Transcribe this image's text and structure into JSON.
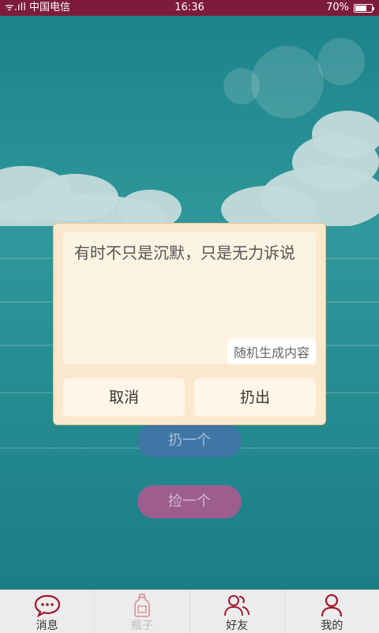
{
  "status_bar": {
    "carrier": "中国电信",
    "time": "16:36",
    "battery": "70%",
    "battery_level": 0.7
  },
  "main": {
    "throw_one_label": "扔一个",
    "pick_one_label": "捡一个"
  },
  "dialog": {
    "message": "有时不只是沉默，只是无力诉说",
    "random_button": "随机生成内容",
    "cancel_label": "取消",
    "throw_label": "扔出"
  },
  "bottom_nav": {
    "items": [
      {
        "label": "消息",
        "icon": "message-icon"
      },
      {
        "label": "瓶子",
        "icon": "bottle-icon"
      },
      {
        "label": "好友",
        "icon": "friends-icon"
      },
      {
        "label": "我的",
        "icon": "profile-icon"
      }
    ]
  },
  "colors": {
    "status_bar": "#7d1c3a",
    "accent": "#a0182e",
    "dialog_bg": "#fbe9cd"
  }
}
